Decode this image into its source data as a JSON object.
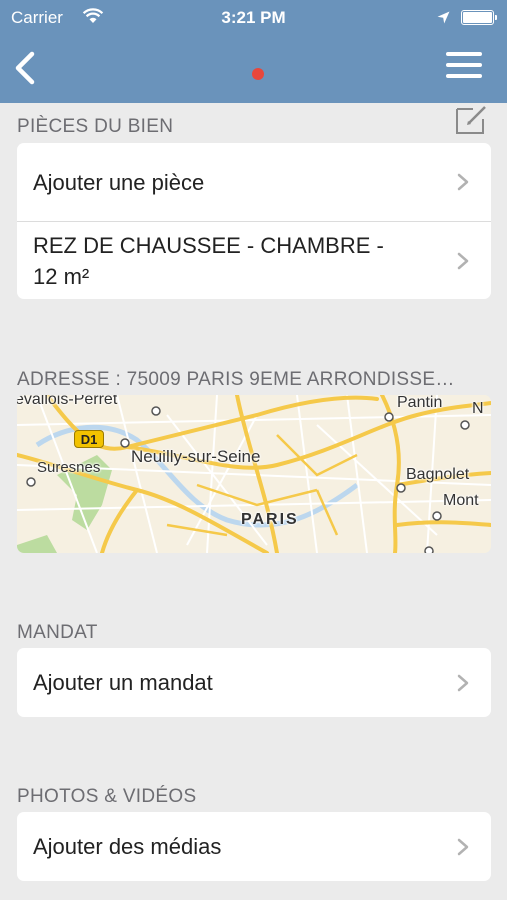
{
  "status_bar": {
    "carrier": "Carrier",
    "time": "3:21 PM",
    "icons": [
      "wifi-icon",
      "location-arrow-icon",
      "battery-icon"
    ]
  },
  "nav_bar": {
    "background_color": "#6a93bb",
    "indicator_color": "#e8473b",
    "icons": [
      "back-chevron-icon",
      "hamburger-menu-icon"
    ]
  },
  "sections": {
    "rooms": {
      "title": "PIÈCES DU BIEN",
      "add_label": "Ajouter une pièce",
      "items": [
        {
          "line1": "REZ DE CHAUSSEE - CHAMBRE -",
          "line2": "12 m²"
        }
      ]
    },
    "address": {
      "title": "ADRESSE : 75009 PARIS 9EME ARRONDISSE…",
      "map": {
        "road_badge": "D1",
        "places": [
          "evallois-Perret",
          "Pantin",
          "N",
          "Suresnes",
          "Neuilly-sur-Seine",
          "Bagnolet",
          "Mont",
          "PARIS"
        ]
      }
    },
    "mandate": {
      "title": "MANDAT",
      "add_label": "Ajouter un mandat"
    },
    "media": {
      "title": "PHOTOS & VIDÉOS",
      "add_label": "Ajouter des médias"
    }
  }
}
